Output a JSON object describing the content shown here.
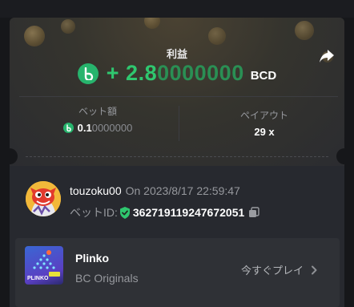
{
  "profit": {
    "label": "利益",
    "sign": "+ ",
    "amount_main": "2.8",
    "amount_trailing": "0000000",
    "currency": "BCD"
  },
  "bet_amount": {
    "label": "ベット額",
    "value_main": "0.1",
    "value_trailing": "0000000"
  },
  "payout": {
    "label": "ペイアウト",
    "value": "29 x"
  },
  "user": {
    "name": "touzoku00",
    "timestamp": "On 2023/8/17 22:59:47"
  },
  "bet": {
    "id_label": "ベットID:",
    "id_value": "362719119247672051"
  },
  "game": {
    "name": "Plinko",
    "provider": "BC Originals",
    "thumbnail_text": "PLINKO",
    "play_label": "今すぐプレイ"
  },
  "icons": {
    "currency": "bcd-coin-icon",
    "share": "share-arrow-icon",
    "verified": "shield-check-icon",
    "copy": "copy-icon",
    "chevron": "chevron-right-icon"
  },
  "colors": {
    "accent_green": "#2fc76f",
    "card_bg": "#27292f",
    "muted_text": "#96989d"
  }
}
